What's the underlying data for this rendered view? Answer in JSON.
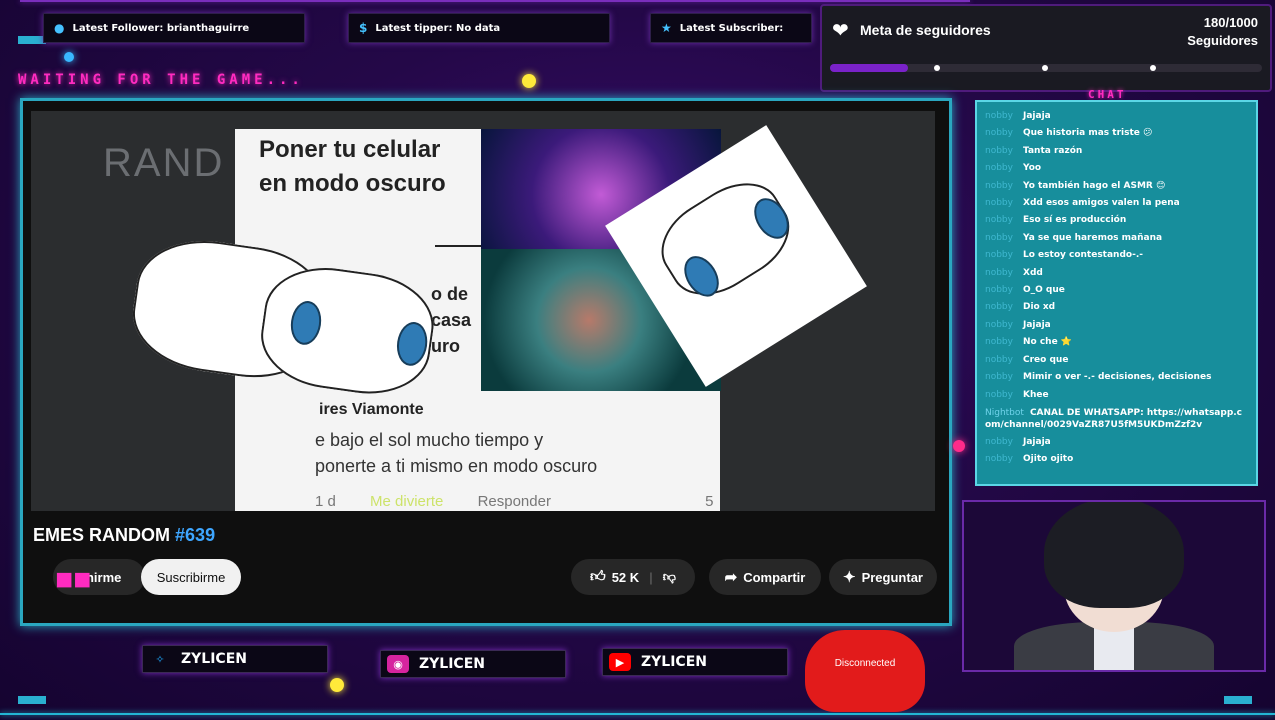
{
  "top_bars": {
    "follower": {
      "icon": "user-icon",
      "text": "Latest Follower: brianthaguirre"
    },
    "tipper": {
      "icon": "dollar-icon",
      "text": "Latest tipper: No data"
    },
    "subscriber": {
      "icon": "star-icon",
      "text": "Latest Subscriber:"
    }
  },
  "waiting_text": "WAITING FOR THE GAME...",
  "goal": {
    "title": "Meta de seguidores",
    "count": "180/1000",
    "unit": "Seguidores",
    "progress": 0.18
  },
  "video": {
    "meme_title": "Poner tu celular\nen modo oscuro",
    "meme_side_text": "o de\ncasa\nuro",
    "comment_author": "ires Viamonte",
    "comment_text": "e bajo el sol mucho tiempo y\nponerte a ti mismo en modo oscuro",
    "comment_time": "1 d",
    "comment_fun": "Me divierte",
    "comment_reply": "Responder",
    "comment_reactions": "5",
    "watermark": "RAND",
    "title_prefix": "EMES RANDOM",
    "title_number": "#639",
    "like_label": "Unirme",
    "subscribe_label": "Suscribirme",
    "likes": "52 K",
    "share_label": "Compartir",
    "ask_label": "Preguntar"
  },
  "chat": {
    "title": "CHAT",
    "messages": [
      {
        "user": "nobby",
        "text": "Jajaja"
      },
      {
        "user": "nobby",
        "text": "Que historia mas triste 😕"
      },
      {
        "user": "nobby",
        "text": "Tanta razón"
      },
      {
        "user": "nobby",
        "text": "Yoo"
      },
      {
        "user": "nobby",
        "text": "Yo también hago el ASMR 😊"
      },
      {
        "user": "nobby",
        "text": "Xdd esos amigos valen la pena"
      },
      {
        "user": "nobby",
        "text": "Eso sí es producción"
      },
      {
        "user": "nobby",
        "text": "Ya se que haremos mañana"
      },
      {
        "user": "nobby",
        "text": "Lo estoy contestando-.-"
      },
      {
        "user": "nobby",
        "text": "Xdd"
      },
      {
        "user": "nobby",
        "text": "O_O que"
      },
      {
        "user": "nobby",
        "text": "Dio xd"
      },
      {
        "user": "nobby",
        "text": "Jajaja"
      },
      {
        "user": "nobby",
        "text": "No che ⭐"
      },
      {
        "user": "nobby",
        "text": "Creo que"
      },
      {
        "user": "nobby",
        "text": "Mimir o ver -.- decisiones, decisiones"
      },
      {
        "user": "nobby",
        "text": "Khee"
      }
    ],
    "whatsapp": {
      "user": "Nightbot",
      "text": "CANAL DE WHATSAPP: https://whatsapp.com/channel/0029VaZR87U5fM5UKDmZzf2v"
    },
    "after": [
      {
        "user": "nobby",
        "text": "Jajaja"
      },
      {
        "user": "nobby",
        "text": "Ojito ojito"
      }
    ]
  },
  "socials": {
    "twitter": {
      "icon": "twitter-icon",
      "handle": "ZYLICEN",
      "color": "#1da1f2"
    },
    "instagram": {
      "icon": "instagram-icon",
      "handle": "ZYLICEN",
      "color": "#d6249f"
    },
    "youtube": {
      "icon": "youtube-icon",
      "handle": "ZYLICEN",
      "color": "#ff0000"
    }
  },
  "controller": {
    "status": "Disconnected",
    "color": "#e21b1b"
  },
  "colors": {
    "accent": "#23b6d4",
    "magenta": "#ff2bc0",
    "purple": "#7a22c9"
  }
}
